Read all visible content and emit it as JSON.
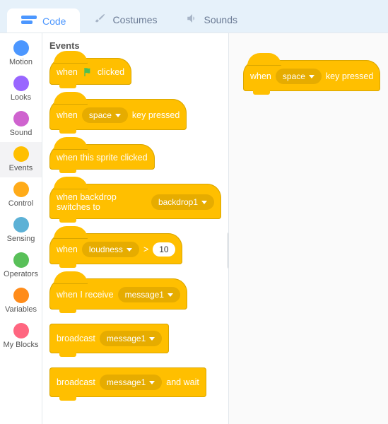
{
  "tabs": {
    "code": "Code",
    "costumes": "Costumes",
    "sounds": "Sounds"
  },
  "categories": {
    "motion": "Motion",
    "looks": "Looks",
    "sound": "Sound",
    "events": "Events",
    "control": "Control",
    "sensing": "Sensing",
    "operators": "Operators",
    "variables": "Variables",
    "myblocks": "My Blocks"
  },
  "palette": {
    "heading": "Events",
    "blocks": {
      "flag": {
        "prefix": "when",
        "suffix": "clicked"
      },
      "key": {
        "prefix": "when",
        "dd": "space",
        "suffix": "key pressed"
      },
      "sprite": {
        "text": "when this sprite clicked"
      },
      "backdrop": {
        "prefix": "when backdrop switches to",
        "dd": "backdrop1"
      },
      "loudness": {
        "prefix": "when",
        "dd": "loudness",
        "op": ">",
        "val": "10"
      },
      "receive": {
        "prefix": "when I receive",
        "dd": "message1"
      },
      "broadcast": {
        "prefix": "broadcast",
        "dd": "message1"
      },
      "broadcast_wait": {
        "prefix": "broadcast",
        "dd": "message1",
        "suffix": "and wait"
      }
    }
  },
  "workspace": {
    "block": {
      "prefix": "when",
      "dd": "space",
      "suffix": "key pressed"
    }
  }
}
